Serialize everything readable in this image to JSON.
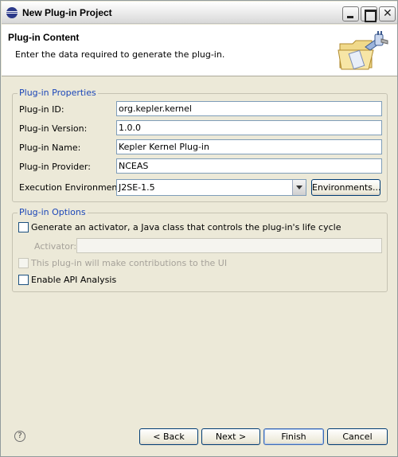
{
  "window": {
    "title": "New Plug-in Project"
  },
  "header": {
    "title": "Plug-in Content",
    "description": "Enter the data required to generate the plug-in."
  },
  "properties": {
    "group_label": "Plug-in Properties",
    "id_label": "Plug-in ID:",
    "id_value": "org.kepler.kernel",
    "version_label": "Plug-in Version:",
    "version_value": "1.0.0",
    "name_label": "Plug-in Name:",
    "name_value": "Kepler Kernel Plug-in",
    "provider_label": "Plug-in Provider:",
    "provider_value": "NCEAS",
    "env_label": "Execution Environment:",
    "env_value": "J2SE-1.5",
    "environments_button": "Environments..."
  },
  "options": {
    "group_label": "Plug-in Options",
    "generate_activator": "Generate an activator, a Java class that controls the plug-in's life cycle",
    "activator_label": "Activator:",
    "activator_value": "",
    "ui_contributions": "This plug-in will make contributions to the UI",
    "api_analysis": "Enable API Analysis"
  },
  "footer": {
    "help_glyph": "?",
    "back": "< Back",
    "next": "Next >",
    "finish": "Finish",
    "cancel": "Cancel"
  },
  "icons": {
    "app": "eclipse-icon",
    "wizard": "folder-plug-icon",
    "close_glyph": "✕"
  }
}
